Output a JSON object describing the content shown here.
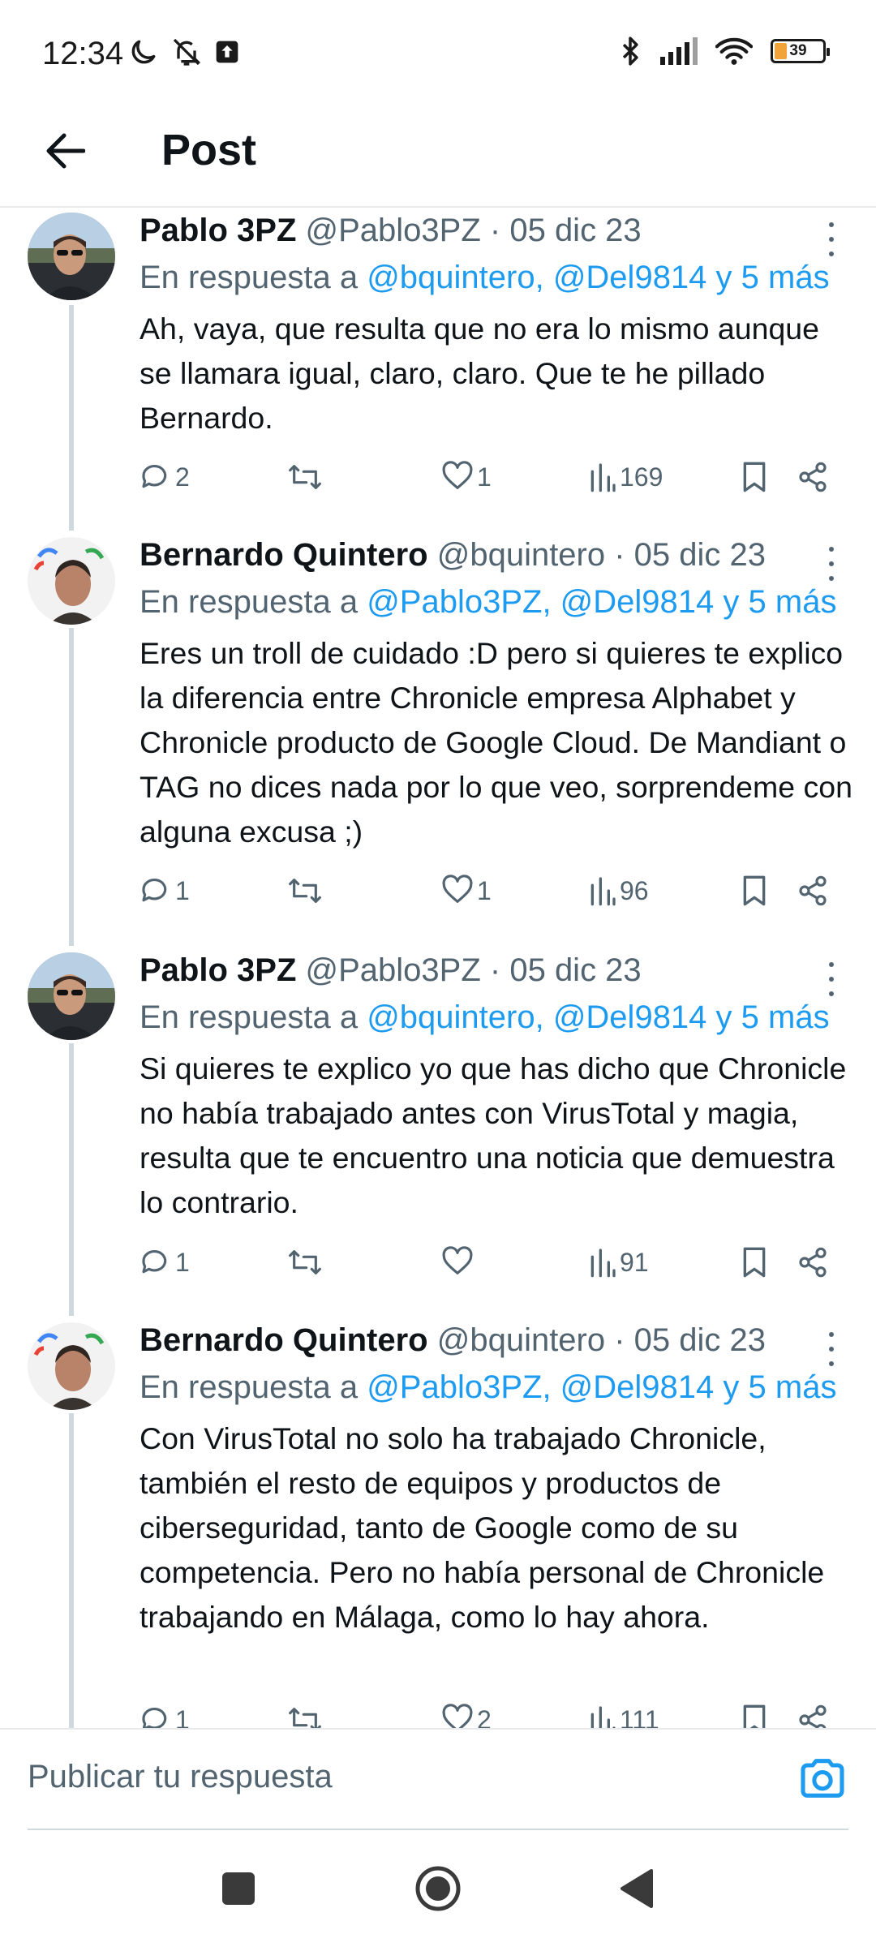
{
  "status_bar": {
    "time": "12:34",
    "battery": "39",
    "left_icons": [
      "moon-icon",
      "notifications-off-icon",
      "upload-icon"
    ],
    "right_icons": [
      "bluetooth-icon",
      "signal-icon",
      "wifi-icon",
      "battery-icon"
    ]
  },
  "header": {
    "title": "Post",
    "back_icon": "arrow-left-icon"
  },
  "posts": [
    {
      "name": "Pablo 3PZ",
      "meta": "@Pablo3PZ · 05 dic 23",
      "reply_prefix": "En respuesta a",
      "reply_mentions": "@bquintero, @Del9814 y 5 más",
      "text": "Ah, vaya, que resulta que no era lo mismo aunque se llamara igual, claro, claro. Que te he pillado Bernardo.",
      "replies": "2",
      "retweets": "",
      "likes": "1",
      "views": "169"
    },
    {
      "name": "Bernardo Quintero",
      "meta": "@bquintero · 05 dic 23",
      "reply_prefix": "En respuesta a",
      "reply_mentions": "@Pablo3PZ, @Del9814 y 5 más",
      "text": "Eres un troll de cuidado :D pero si quieres te explico la diferencia entre Chronicle empresa Alphabet y Chronicle producto de Google Cloud. De Mandiant o TAG no dices nada por lo que veo, sorprendeme con alguna excusa ;)",
      "replies": "1",
      "retweets": "",
      "likes": "1",
      "views": "96"
    },
    {
      "name": "Pablo 3PZ",
      "meta": "@Pablo3PZ · 05 dic 23",
      "reply_prefix": "En respuesta a",
      "reply_mentions": "@bquintero, @Del9814 y 5 más",
      "text": "Si quieres te explico yo que has dicho que Chronicle no había trabajado antes con VirusTotal y magia, resulta que te encuentro una noticia que demuestra lo contrario.",
      "replies": "1",
      "retweets": "",
      "likes": "",
      "views": "91"
    },
    {
      "name": "Bernardo Quintero",
      "meta": "@bquintero · 05 dic 23",
      "reply_prefix": "En respuesta a",
      "reply_mentions": "@Pablo3PZ, @Del9814 y 5 más",
      "text": "Con VirusTotal no solo ha trabajado Chronicle, también el resto de equipos y productos de ciberseguridad, tanto de Google como de su competencia. Pero no había personal de Chronicle trabajando en Málaga, como lo hay ahora.",
      "replies": "1",
      "retweets": "",
      "likes": "2",
      "views": "111"
    }
  ],
  "compose": {
    "placeholder": "Publicar tu respuesta",
    "camera_icon": "camera-icon"
  },
  "nav": {
    "buttons": [
      "recents-square-icon",
      "home-circle-icon",
      "back-triangle-icon"
    ]
  },
  "colors": {
    "accent": "#1d9bf0",
    "text": "#0f1419",
    "secondary": "#536471",
    "divider": "#e7e9ea",
    "thread_line": "#cfd9de",
    "battery": "#f2a33a"
  }
}
